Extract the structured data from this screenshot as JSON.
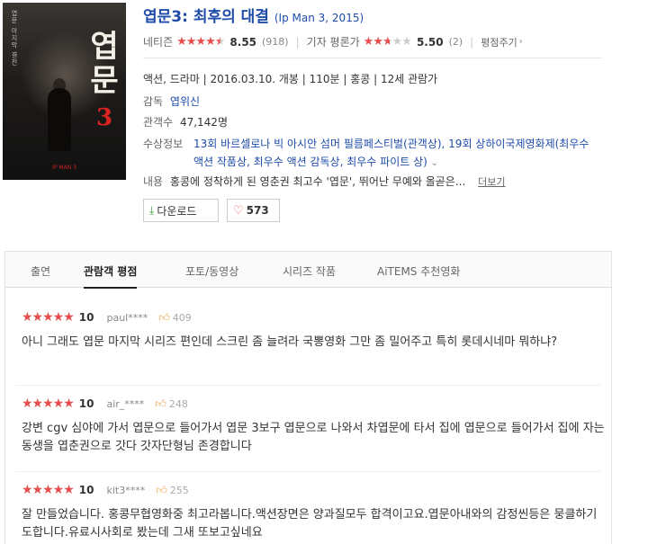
{
  "movie": {
    "title": "엽문3: 최후의 대결",
    "title_en": "(Ip Man 3, 2015)",
    "poster_text": "엽문",
    "poster_number": "3"
  },
  "ratings": {
    "netizen_label": "네티즌",
    "netizen_score": "8.55",
    "netizen_count": "(918)",
    "netizen_value": 8.55,
    "critic_label": "기자 평론가",
    "critic_score": "5.50",
    "critic_count": "(2)",
    "critic_value": 5.5,
    "rate_label": "평점주기"
  },
  "info": {
    "meta": "액션, 드라마 | 2016.03.10. 개봉 | 110분 | 홍콩 | 12세 관람가",
    "director_label": "감독",
    "director": "엽위신",
    "audience_label": "관객수",
    "audience": "47,142명",
    "awards_label": "수상정보",
    "awards": "13회 바르셀로나 빅 아시안 섬머 필름페스티벌(관객상), 19회 상하이국제영화제(최우수 액션 작품상, 최우수 액션 감독상, 최우수 파이트 상)",
    "plot_label": "내용",
    "plot": "홍콩에 정착하게 된 영춘권 최고수 '엽문', 뛰어난 무예와 올곧은...",
    "more": "더보기"
  },
  "buttons": {
    "download": "다운로드",
    "likes": "573"
  },
  "tabs": [
    "출연",
    "관람객 평점",
    "포토/동영상",
    "시리즈 작품",
    "AiTEMS 추천영화"
  ],
  "reviews": [
    {
      "score": "10",
      "user": "paul****",
      "likes": "409",
      "text": "아니 그래도 엽문 마지막 시리즈 편인데 스크린 좀 늘려라 국뽕영화 그만 좀 밀어주고 특히 롯데시네마 뭐하냐?"
    },
    {
      "score": "10",
      "user": "air_****",
      "likes": "248",
      "text": "강변 cgv 심야에 가서 엽문으로 들어가서 엽문 3보구 엽문으로 나와서 차엽문에 타서 집에 엽문으로 들어가서 집에 자는 동생을 엽춘권으로 갓다 갓자단형님 존경합니다"
    },
    {
      "score": "10",
      "user": "kit3****",
      "likes": "255",
      "text": "잘 만들었습니다. 홍콩무협영화중 최고라봅니다.액션장면은 양과질모두 합격이고요.엽문아내와의 감정씬등은 뭉클하기도합니다.유료시사회로 봤는데 그새 또보고싶네요"
    }
  ],
  "colors": {
    "accent": "#1e4ca8",
    "star": "#e84d4d"
  }
}
